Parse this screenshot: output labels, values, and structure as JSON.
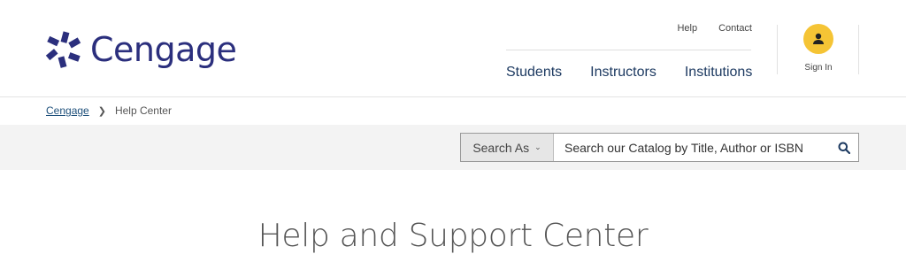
{
  "brand": {
    "name": "Cengage",
    "color": "#2b2f7d"
  },
  "utility_nav": {
    "help": "Help",
    "contact": "Contact"
  },
  "main_nav": [
    {
      "label": "Students"
    },
    {
      "label": "Instructors"
    },
    {
      "label": "Institutions"
    }
  ],
  "account": {
    "signin_label": "Sign In",
    "icon": "user-icon",
    "avatar_color": "#f5c435"
  },
  "breadcrumb": {
    "home": "Cengage",
    "current": "Help Center"
  },
  "search": {
    "scope_label": "Search As",
    "placeholder": "Search our Catalog by Title, Author or ISBN",
    "button_icon": "search-icon"
  },
  "page": {
    "title": "Help and Support Center"
  }
}
